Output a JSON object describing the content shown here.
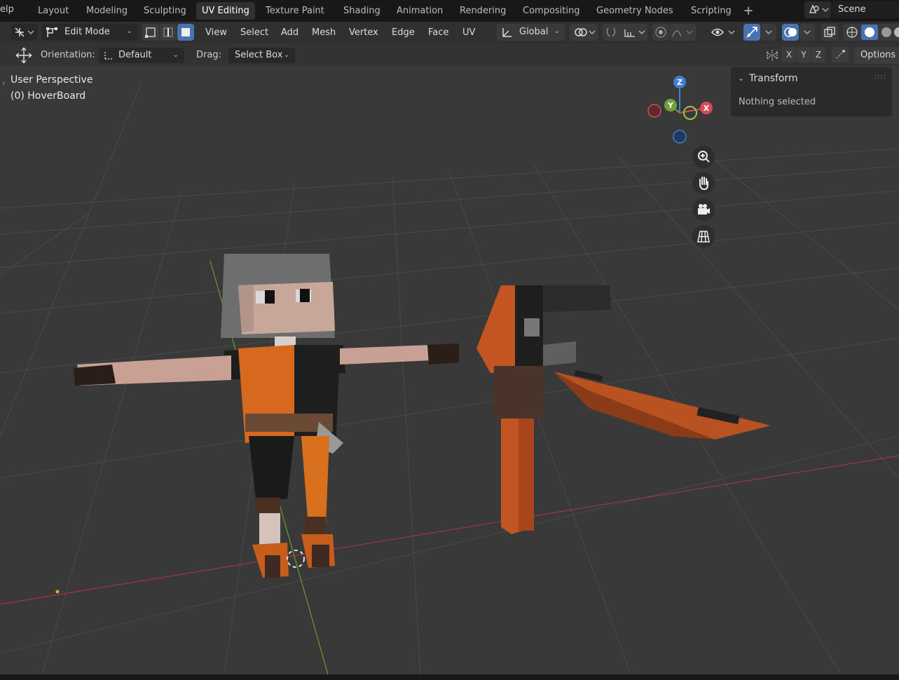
{
  "topbar": {
    "help_label": "elp",
    "workspaces": [
      {
        "label": "Layout"
      },
      {
        "label": "Modeling"
      },
      {
        "label": "Sculpting"
      },
      {
        "label": "UV Editing"
      },
      {
        "label": "Texture Paint"
      },
      {
        "label": "Shading"
      },
      {
        "label": "Animation"
      },
      {
        "label": "Rendering"
      },
      {
        "label": "Compositing"
      },
      {
        "label": "Geometry Nodes"
      },
      {
        "label": "Scripting"
      }
    ],
    "active_workspace": "UV Editing",
    "add_workspace_icon": "plus-icon",
    "scene_label": "Scene"
  },
  "header": {
    "mode": "Edit Mode",
    "menus": [
      "View",
      "Select",
      "Add",
      "Mesh",
      "Vertex",
      "Edge",
      "Face",
      "UV"
    ],
    "transform_orientation": "Global"
  },
  "tool_settings": {
    "orientation_label": "Orientation:",
    "orientation_value": "Default",
    "drag_label": "Drag:",
    "drag_value": "Select Box",
    "axes": [
      "X",
      "Y",
      "Z"
    ],
    "options_label": "Options"
  },
  "viewport": {
    "view_name": "User Perspective",
    "object_name": "(0) HoverBoard",
    "gizmo_axes": {
      "z": "Z",
      "y": "Y",
      "x": "X"
    },
    "colors": {
      "x": "#d84a55",
      "y": "#6ea13c",
      "z": "#3f7fd5",
      "grid_x": "#a8333c",
      "grid_y": "#6d9a2d"
    }
  },
  "transform_panel": {
    "title": "Transform",
    "body": "Nothing selected"
  }
}
